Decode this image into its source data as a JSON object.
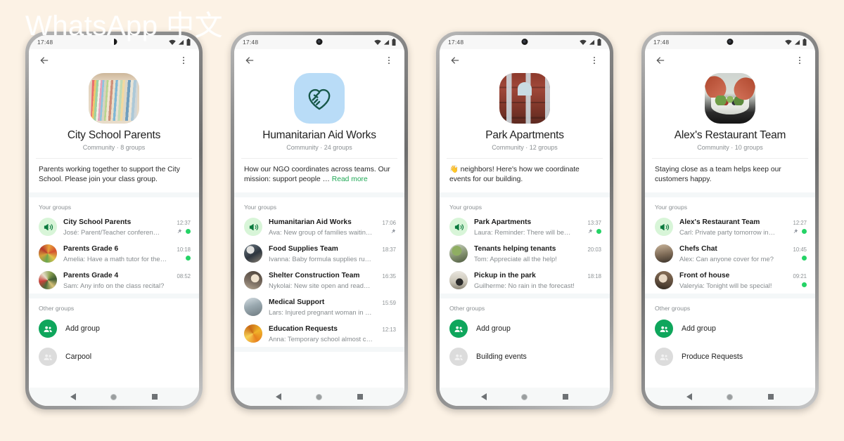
{
  "watermark": "WhatsApp 中文",
  "background_color": "#fcf2e5",
  "accent_color": "#25d366",
  "link_color": "#1fa855",
  "common": {
    "status_time": "17:48",
    "section_your_groups": "Your groups",
    "section_other_groups": "Other groups",
    "back_icon": "arrow-left-icon",
    "menu_icon": "overflow-menu-icon",
    "wifi_icon": "wifi-icon",
    "signal_icon": "signal-icon",
    "battery_icon": "battery-icon",
    "nav_back": "nav-back-icon",
    "nav_home": "nav-home-icon",
    "nav_recents": "nav-recents-icon",
    "add_group_label": "Add group"
  },
  "phones": [
    {
      "id": "city-school-parents",
      "avatar_art": "art-books",
      "title": "City School Parents",
      "subtitle": "Community · 8 groups",
      "description": "Parents working together to support the City School. Please join your class group.",
      "read_more": "",
      "groups": [
        {
          "name": "City School Parents",
          "message": "José: Parent/Teacher conferen…",
          "time": "12:37",
          "announcement": true,
          "pinned": true,
          "unread": true,
          "art": ""
        },
        {
          "name": "Parents Grade 6",
          "message": "Amelia: Have a math tutor for the…",
          "time": "10:18",
          "announcement": false,
          "pinned": false,
          "unread": true,
          "art": "art-g1"
        },
        {
          "name": "Parents Grade 4",
          "message": "Sam: Any info on the class recital?",
          "time": "08:52",
          "announcement": false,
          "pinned": false,
          "unread": false,
          "art": "art-g2"
        }
      ],
      "other_groups": [
        "Carpool"
      ]
    },
    {
      "id": "humanitarian-aid-works",
      "avatar_art": "art-heart",
      "title": "Humanitarian Aid Works",
      "subtitle": "Community · 24 groups",
      "description": "How our NGO coordinates across teams. Our mission: support people … ",
      "read_more": "Read more",
      "groups": [
        {
          "name": "Humanitarian Aid Works",
          "message": "Ava: New group of families waitin…",
          "time": "17:06",
          "announcement": true,
          "pinned": true,
          "unread": false,
          "art": ""
        },
        {
          "name": "Food Supplies Team",
          "message": "Ivanna: Baby formula supplies running …",
          "time": "18:37",
          "announcement": false,
          "pinned": false,
          "unread": false,
          "art": "art-g3"
        },
        {
          "name": "Shelter Construction Team",
          "message": "Nykolai: New site open and ready for …",
          "time": "16:35",
          "announcement": false,
          "pinned": false,
          "unread": false,
          "art": "art-g4"
        },
        {
          "name": "Medical Support",
          "message": "Lars: Injured pregnant woman in need…",
          "time": "15:59",
          "announcement": false,
          "pinned": false,
          "unread": false,
          "art": "art-g5"
        },
        {
          "name": "Education Requests",
          "message": "Anna: Temporary school almost comp…",
          "time": "12:13",
          "announcement": false,
          "pinned": false,
          "unread": false,
          "art": "art-g6"
        }
      ],
      "other_groups": []
    },
    {
      "id": "park-apartments",
      "avatar_art": "art-building",
      "title": "Park Apartments",
      "subtitle": "Community · 12 groups",
      "description": "👋 neighbors! Here's how we coordinate events for our building.",
      "read_more": "",
      "groups": [
        {
          "name": "Park Apartments",
          "message": "Laura: Reminder: There will be…",
          "time": "13:37",
          "announcement": true,
          "pinned": true,
          "unread": true,
          "art": ""
        },
        {
          "name": "Tenants helping tenants",
          "message": "Tom: Appreciate all the help!",
          "time": "20:03",
          "announcement": false,
          "pinned": false,
          "unread": false,
          "art": "art-g7"
        },
        {
          "name": "Pickup in the park",
          "message": "Guilherme: No rain in the forecast!",
          "time": "18:18",
          "announcement": false,
          "pinned": false,
          "unread": false,
          "art": "art-g8"
        }
      ],
      "other_groups": [
        "Building events"
      ]
    },
    {
      "id": "alexs-restaurant-team",
      "avatar_art": "art-food",
      "title": "Alex's Restaurant Team",
      "subtitle": "Community · 10 groups",
      "description": "Staying close as a team helps keep our customers happy.",
      "read_more": "",
      "groups": [
        {
          "name": "Alex's Restaurant Team",
          "message": "Carl: Private party tomorrow in…",
          "time": "12:27",
          "announcement": true,
          "pinned": true,
          "unread": true,
          "art": ""
        },
        {
          "name": "Chefs Chat",
          "message": "Alex: Can anyone cover for me?",
          "time": "10:45",
          "announcement": false,
          "pinned": false,
          "unread": true,
          "art": "art-g9"
        },
        {
          "name": "Front of house",
          "message": "Valeryia: Tonight will be special!",
          "time": "09:21",
          "announcement": false,
          "pinned": false,
          "unread": true,
          "art": "art-g10"
        }
      ],
      "other_groups": [
        "Produce Requests"
      ]
    }
  ]
}
